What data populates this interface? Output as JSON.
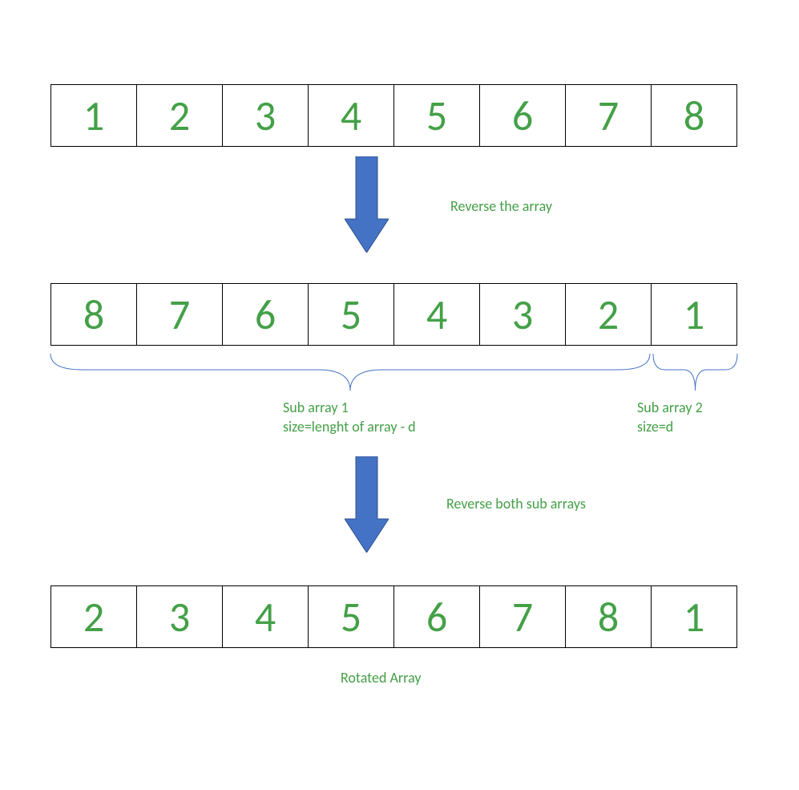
{
  "colors": {
    "number": "#44a047",
    "arrow": "#4472c4",
    "brace": "#4472c4",
    "border": "#000000"
  },
  "arrays": {
    "top": [
      "1",
      "2",
      "3",
      "4",
      "5",
      "6",
      "7",
      "8"
    ],
    "middle": [
      "8",
      "7",
      "6",
      "5",
      "4",
      "3",
      "2",
      "1"
    ],
    "bottom": [
      "2",
      "3",
      "4",
      "5",
      "6",
      "7",
      "8",
      "1"
    ]
  },
  "annotations": {
    "reverse1": "Reverse the array",
    "sub1_line1": "Sub array 1",
    "sub1_line2": "size=lenght of array - d",
    "sub2_line1": "Sub array 2",
    "sub2_line2": "size=d",
    "reverse2": "Reverse both sub arrays",
    "rotated": "Rotated Array"
  }
}
